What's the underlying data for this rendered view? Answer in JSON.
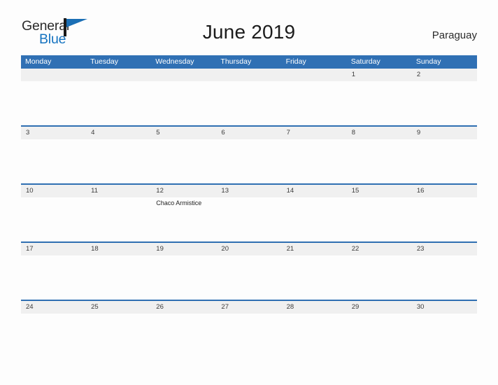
{
  "brand": {
    "name_part1": "General",
    "name_part2": "Blue",
    "mark": "flag-triangle-icon"
  },
  "header": {
    "title": "June 2019",
    "country": "Paraguay"
  },
  "colors": {
    "header_blue": "#3070b4",
    "row_rule_blue": "#2f6fb2",
    "day_band_gray": "#f0f0f0",
    "brand_blue": "#1573c0",
    "page_background": "#fdfdfd"
  },
  "calendar": {
    "weekdays": [
      "Monday",
      "Tuesday",
      "Wednesday",
      "Thursday",
      "Friday",
      "Saturday",
      "Sunday"
    ],
    "weeks": [
      [
        {
          "date": "",
          "events": []
        },
        {
          "date": "",
          "events": []
        },
        {
          "date": "",
          "events": []
        },
        {
          "date": "",
          "events": []
        },
        {
          "date": "",
          "events": []
        },
        {
          "date": "1",
          "events": []
        },
        {
          "date": "2",
          "events": []
        }
      ],
      [
        {
          "date": "3",
          "events": []
        },
        {
          "date": "4",
          "events": []
        },
        {
          "date": "5",
          "events": []
        },
        {
          "date": "6",
          "events": []
        },
        {
          "date": "7",
          "events": []
        },
        {
          "date": "8",
          "events": []
        },
        {
          "date": "9",
          "events": []
        }
      ],
      [
        {
          "date": "10",
          "events": []
        },
        {
          "date": "11",
          "events": []
        },
        {
          "date": "12",
          "events": [
            "Chaco Armistice"
          ]
        },
        {
          "date": "13",
          "events": []
        },
        {
          "date": "14",
          "events": []
        },
        {
          "date": "15",
          "events": []
        },
        {
          "date": "16",
          "events": []
        }
      ],
      [
        {
          "date": "17",
          "events": []
        },
        {
          "date": "18",
          "events": []
        },
        {
          "date": "19",
          "events": []
        },
        {
          "date": "20",
          "events": []
        },
        {
          "date": "21",
          "events": []
        },
        {
          "date": "22",
          "events": []
        },
        {
          "date": "23",
          "events": []
        }
      ],
      [
        {
          "date": "24",
          "events": []
        },
        {
          "date": "25",
          "events": []
        },
        {
          "date": "26",
          "events": []
        },
        {
          "date": "27",
          "events": []
        },
        {
          "date": "28",
          "events": []
        },
        {
          "date": "29",
          "events": []
        },
        {
          "date": "30",
          "events": []
        }
      ]
    ]
  }
}
